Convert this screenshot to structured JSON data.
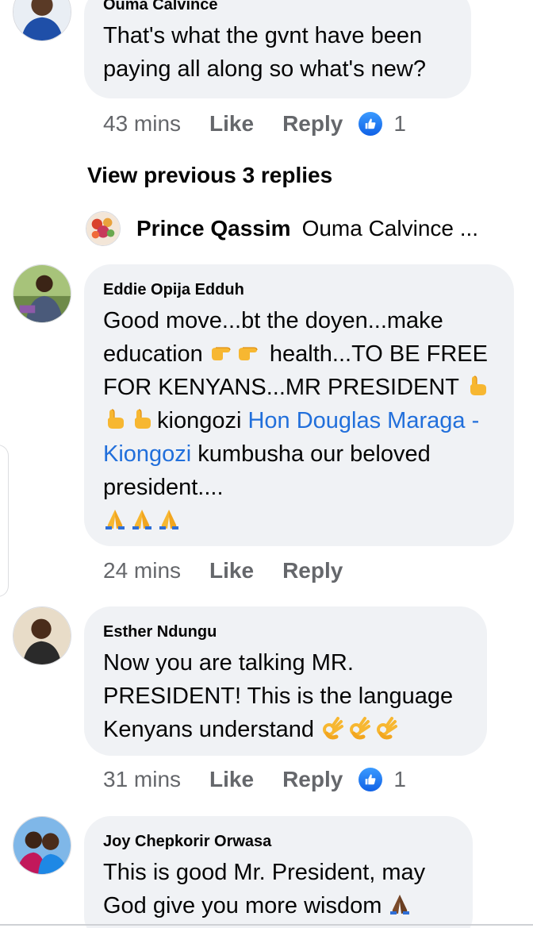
{
  "top_comment": {
    "author": "Ouma Calvince",
    "text": "That's what the gvnt have been paying all along so what's new?",
    "time": "43 mins",
    "like_label": "Like",
    "reply_label": "Reply",
    "reaction_count": "1"
  },
  "view_previous": "View previous 3 replies",
  "reply_preview": {
    "name": "Prince Qassim",
    "snippet": "Ouma Calvince ..."
  },
  "comments": [
    {
      "author": "Eddie Opija Edduh",
      "text_part1": "Good move...bt the doyen...make education ",
      "text_part2": " health...TO BE FREE FOR KENYANS...MR PRESIDENT ",
      "text_part3": "kiongozi ",
      "mention": "Hon Douglas Maraga - Kiongozi",
      "text_part4": " kumbusha our beloved president....",
      "time": "24 mins",
      "like_label": "Like",
      "reply_label": "Reply"
    },
    {
      "author": "Esther Ndungu",
      "text": "Now you are talking MR. PRESIDENT! This is the language Kenyans understand ",
      "time": "31 mins",
      "like_label": "Like",
      "reply_label": "Reply",
      "reaction_count": "1"
    },
    {
      "author": "Joy Chepkorir Orwasa",
      "text": "This is good Mr. President, may God give you more wisdom "
    }
  ],
  "icons": {
    "like_reaction": "like-reaction-icon",
    "pointing_right": "backhand-pointing-right-emoji",
    "pointing_up": "backhand-pointing-up-emoji",
    "folded_hands": "folded-hands-emoji",
    "ok_hand": "ok-hand-emoji"
  },
  "colors": {
    "bubble": "#f0f2f5",
    "meta_text": "#65676b",
    "mention": "#216fdb",
    "like_blue": "#1877f2"
  }
}
